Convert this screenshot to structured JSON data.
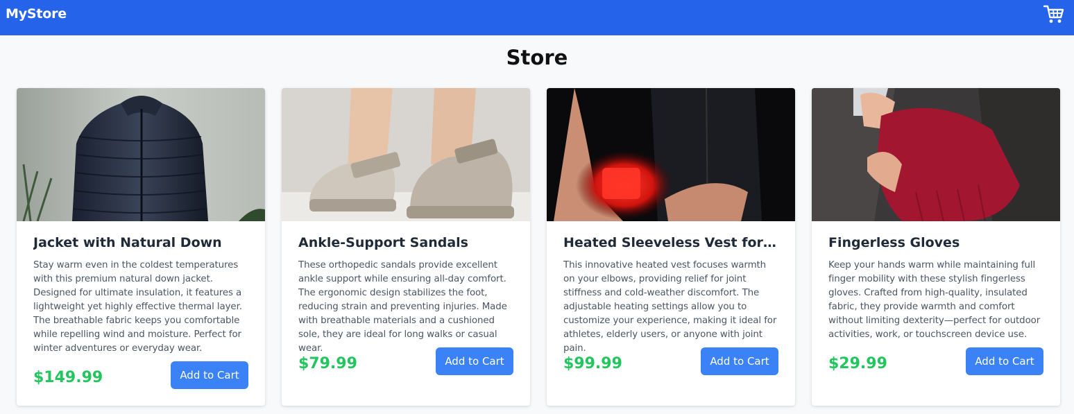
{
  "header": {
    "brand": "MyStore",
    "cart_icon": "cart-icon"
  },
  "page": {
    "title": "Store"
  },
  "products": [
    {
      "name": "Jacket with Natural Down",
      "description": "Stay warm even in the coldest temperatures with this premium natural down jacket. Designed for ultimate insulation, it features a lightweight yet highly effective thermal layer. The breathable fabric keeps you comfortable while repelling wind and moisture. Perfect for winter adventures or everyday wear.",
      "price": "$149.99",
      "button_label": "Add to Cart"
    },
    {
      "name": "Ankle-Support Sandals",
      "description": "These orthopedic sandals provide excellent ankle support while ensuring all-day comfort. The ergonomic design stabilizes the foot, reducing strain and preventing injuries. Made with breathable materials and a cushioned sole, they are ideal for long walks or casual wear.",
      "price": "$79.99",
      "button_label": "Add to Cart"
    },
    {
      "name": "Heated Sleeveless Vest for El...",
      "description": "This innovative heated vest focuses warmth on your elbows, providing relief for joint stiffness and cold-weather discomfort. The adjustable heating settings allow you to customize your experience, making it ideal for athletes, elderly users, or anyone with joint pain.",
      "price": "$99.99",
      "button_label": "Add to Cart"
    },
    {
      "name": "Fingerless Gloves",
      "description": "Keep your hands warm while maintaining full finger mobility with these stylish fingerless gloves. Crafted from high-quality, insulated fabric, they provide warmth and comfort without limiting dexterity—perfect for outdoor activities, work, or touchscreen device use.",
      "price": "$29.99",
      "button_label": "Add to Cart"
    }
  ],
  "colors": {
    "navbar": "#2563eb",
    "button": "#3b82f6",
    "price": "#22c55e"
  }
}
